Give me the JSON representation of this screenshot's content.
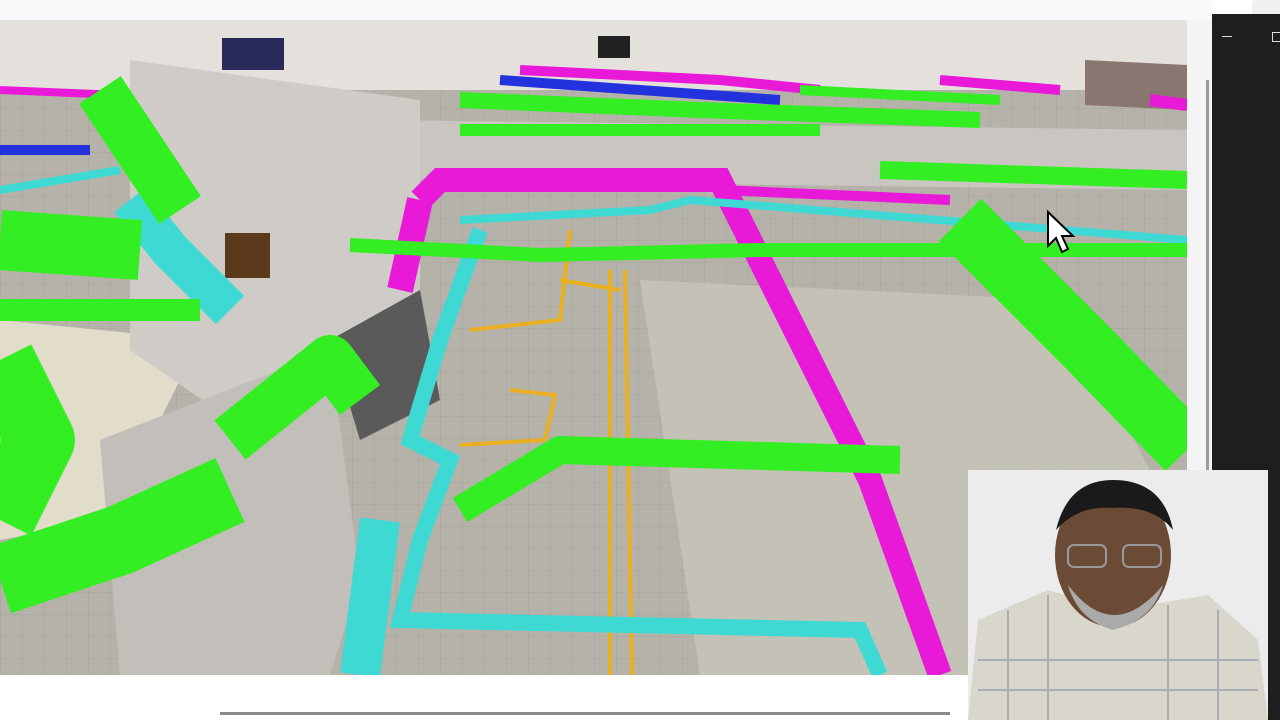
{
  "viewer": {
    "model_type": "3D MEP model",
    "colors": {
      "duct_green": "#33ee22",
      "pipe_magenta": "#e81ad8",
      "pipe_cyan": "#3fd9d4",
      "pipe_yellow": "#e8b020",
      "wall_gray": "#d6d3cf",
      "floor": "#b9b6ad"
    }
  },
  "window_controls": {
    "minimize_icon": "minimize-icon",
    "maximize_icon": "maximize-icon"
  },
  "cursor_icon": "mouse-pointer-icon"
}
